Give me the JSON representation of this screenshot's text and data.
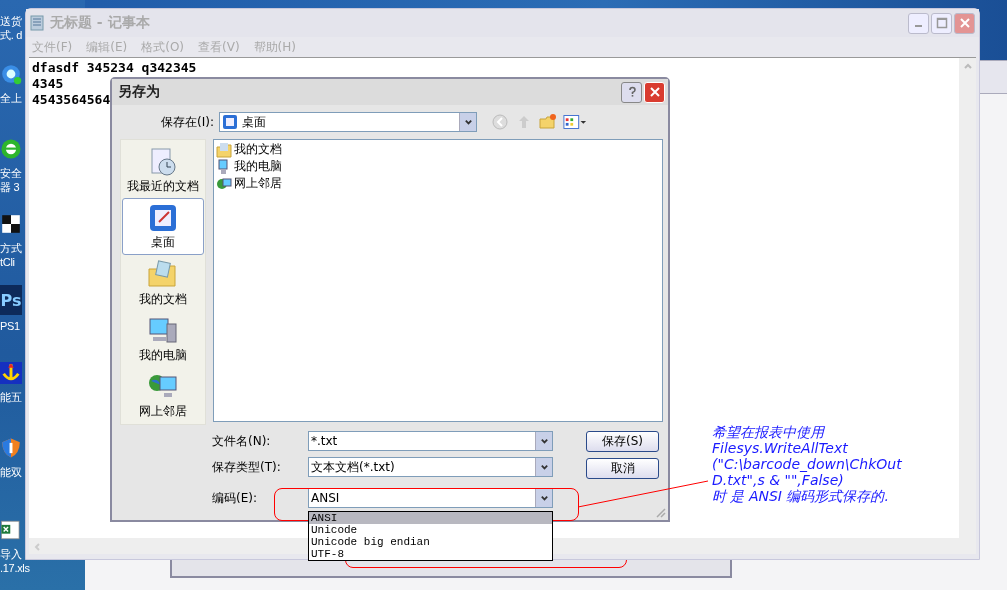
{
  "desktop_icons": [
    {
      "kind": "none",
      "lines": [
        "送货",
        "式. d"
      ]
    },
    {
      "kind": "browser",
      "lines": [
        "全上"
      ]
    },
    {
      "kind": "browser-green",
      "lines": [
        "安全",
        "器 3"
      ]
    },
    {
      "kind": "cube",
      "lines": [
        "方式",
        "tCli"
      ]
    },
    {
      "kind": "ps",
      "text": "Ps",
      "lines": [
        "PS1"
      ]
    },
    {
      "kind": "anchor",
      "lines": [
        "能五"
      ]
    },
    {
      "kind": "shield",
      "lines": [
        "能双"
      ]
    },
    {
      "kind": "sheet",
      "lines": [
        "导入",
        ".17.xls"
      ]
    }
  ],
  "notepad": {
    "title": "无标题 - 记事本",
    "active": false,
    "menu": [
      "文件(F)",
      "编辑(E)",
      "格式(O)",
      "查看(V)",
      "帮助(H)"
    ],
    "text_lines": [
      "dfasdf 345234 q342345",
      "4345",
      "4543564564"
    ]
  },
  "dialog": {
    "title": "另存为",
    "save_in_label": "保存在(I):",
    "save_in_value": "桌面",
    "places": [
      {
        "label": "我最近的文档",
        "kind": "recent",
        "selected": false
      },
      {
        "label": "桌面",
        "kind": "desktop",
        "selected": true
      },
      {
        "label": "我的文档",
        "kind": "documents",
        "selected": false
      },
      {
        "label": "我的电脑",
        "kind": "computer",
        "selected": false
      },
      {
        "label": "网上邻居",
        "kind": "network",
        "selected": false
      }
    ],
    "files": [
      {
        "name": "我的文档",
        "kind": "documents"
      },
      {
        "name": "我的电脑",
        "kind": "computer"
      },
      {
        "name": "网上邻居",
        "kind": "network"
      }
    ],
    "fields": [
      {
        "label": "文件名(N):",
        "value": "*.txt"
      },
      {
        "label": "保存类型(T):",
        "value": "文本文档(*.txt)"
      },
      {
        "label": "编码(E):",
        "value": "ANSI"
      }
    ],
    "buttons": [
      "保存(S)",
      "取消"
    ],
    "encoding_options": [
      {
        "label": "ANSI",
        "selected": true
      },
      {
        "label": "Unicode",
        "selected": false
      },
      {
        "label": "Unicode big endian",
        "selected": false
      },
      {
        "label": "UTF-8",
        "selected": false
      }
    ]
  },
  "annotation": {
    "lines": [
      "希望在报表中使用",
      "Filesys.WriteAllText",
      "(\"C:\\barcode_down\\ChkOut",
      "D.txt\",s & \"\",False)",
      "时 是 ANSI 编码形式保存的."
    ]
  }
}
